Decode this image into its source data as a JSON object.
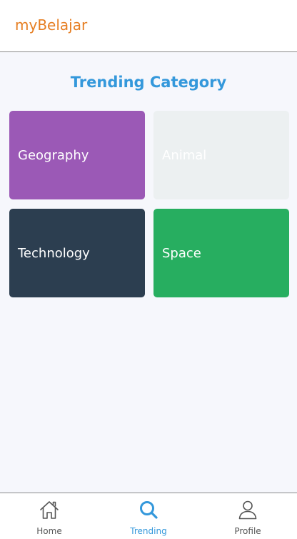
{
  "app": {
    "title": "myBelajar",
    "title_color": "#e67e22"
  },
  "main": {
    "section_title": "Trending Category",
    "section_title_color": "#3498db",
    "categories": [
      {
        "label": "Geography",
        "color": "#9b59b6"
      },
      {
        "label": "Animal",
        "color": "#ecf0f1"
      },
      {
        "label": "Technology",
        "color": "#2c3e50"
      },
      {
        "label": "Space",
        "color": "#27ae60"
      }
    ]
  },
  "bottom_nav": {
    "active_color": "#3498db",
    "inactive_color": "#555555",
    "items": [
      {
        "label": "Home",
        "icon": "home-icon",
        "active": false
      },
      {
        "label": "Trending",
        "icon": "search-icon",
        "active": true
      },
      {
        "label": "Profile",
        "icon": "person-icon",
        "active": false
      }
    ]
  }
}
